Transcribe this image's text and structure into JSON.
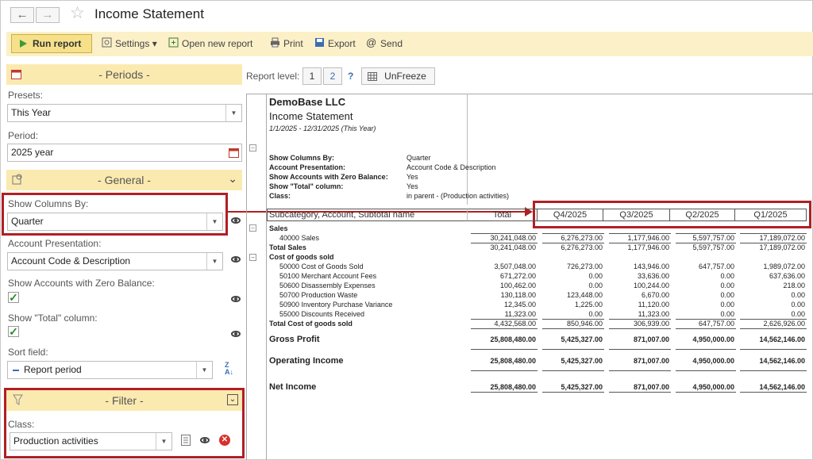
{
  "window": {
    "title": "Income Statement"
  },
  "toolbar": {
    "run_report": "Run report",
    "settings": "Settings",
    "open_new_report": "Open new report",
    "print": "Print",
    "export": "Export",
    "send": "Send"
  },
  "periods": {
    "section_title": "- Periods -",
    "presets_label": "Presets:",
    "presets_value": "This Year",
    "period_label": "Period:",
    "period_value": "2025 year"
  },
  "general": {
    "section_title": "- General -",
    "show_columns_label": "Show Columns By:",
    "show_columns_value": "Quarter",
    "account_presentation_label": "Account Presentation:",
    "account_presentation_value": "Account Code & Description",
    "zero_balance_label": "Show Accounts with Zero Balance:",
    "total_column_label": "Show \"Total\" column:",
    "sort_field_label": "Sort field:",
    "sort_field_value": "Report period"
  },
  "filter": {
    "section_title": "- Filter -",
    "class_label": "Class:",
    "class_value": "Production activities"
  },
  "report_level": {
    "label": "Report level:",
    "level1": "1",
    "level2": "2",
    "help": "?",
    "unfreeze": "UnFreeze"
  },
  "report": {
    "company": "DemoBase LLC",
    "name": "Income Statement",
    "period": "1/1/2025 - 12/31/2025 (This Year)",
    "params": [
      {
        "label": "Show Columns By:",
        "value": "Quarter"
      },
      {
        "label": "Account Presentation:",
        "value": "Account Code & Description"
      },
      {
        "label": "Show Accounts with Zero Balance:",
        "value": "Yes"
      },
      {
        "label": "Show \"Total\" column:",
        "value": "Yes"
      },
      {
        "label": "Class:",
        "value": "in parent - (Production activities)"
      }
    ],
    "headers": [
      "Subcategory, Account, Subtotal name",
      "Total",
      "Q4/2025",
      "Q3/2025",
      "Q2/2025",
      "Q1/2025"
    ],
    "rows": [
      {
        "name": "Sales",
        "values": [
          "",
          "",
          "",
          "",
          ""
        ]
      },
      {
        "name": "40000 Sales",
        "values": [
          "30,241,048.00",
          "6,276,273.00",
          "1,177,946.00",
          "5,597,757.00",
          "17,189,072.00"
        ]
      },
      {
        "name": "Total Sales",
        "values": [
          "30,241,048.00",
          "6,276,273.00",
          "1,177,946.00",
          "5,597,757.00",
          "17,189,072.00"
        ]
      },
      {
        "name": "Cost of goods sold",
        "values": [
          "",
          "",
          "",
          "",
          ""
        ]
      },
      {
        "name": "50000 Cost of Goods Sold",
        "values": [
          "3,507,048.00",
          "726,273.00",
          "143,946.00",
          "647,757.00",
          "1,989,072.00"
        ]
      },
      {
        "name": "50100 Merchant Account Fees",
        "values": [
          "671,272.00",
          "0.00",
          "33,636.00",
          "0.00",
          "637,636.00"
        ]
      },
      {
        "name": "50600 Disassembly Expenses",
        "values": [
          "100,462.00",
          "0.00",
          "100,244.00",
          "0.00",
          "218.00"
        ]
      },
      {
        "name": "50700 Production Waste",
        "values": [
          "130,118.00",
          "123,448.00",
          "6,670.00",
          "0.00",
          "0.00"
        ]
      },
      {
        "name": "50900 Inventory Purchase Variance",
        "values": [
          "12,345.00",
          "1,225.00",
          "11,120.00",
          "0.00",
          "0.00"
        ]
      },
      {
        "name": "55000 Discounts Received",
        "values": [
          "11,323.00",
          "0.00",
          "11,323.00",
          "0.00",
          "0.00"
        ]
      },
      {
        "name": "Total Cost of goods sold",
        "values": [
          "4,432,568.00",
          "850,946.00",
          "306,939.00",
          "647,757.00",
          "2,626,926.00"
        ]
      },
      {
        "name": "Gross Profit",
        "values": [
          "25,808,480.00",
          "5,425,327.00",
          "871,007.00",
          "4,950,000.00",
          "14,562,146.00"
        ]
      },
      {
        "name": "Operating Income",
        "values": [
          "25,808,480.00",
          "5,425,327.00",
          "871,007.00",
          "4,950,000.00",
          "14,562,146.00"
        ]
      },
      {
        "name": "Net Income",
        "values": [
          "25,808,480.00",
          "5,425,327.00",
          "871,007.00",
          "4,950,000.00",
          "14,562,146.00"
        ]
      }
    ]
  },
  "colors": {
    "accent_yellow": "#fbf0c7",
    "highlight_red": "#b01f24",
    "run_green": "#3c9a3c"
  }
}
